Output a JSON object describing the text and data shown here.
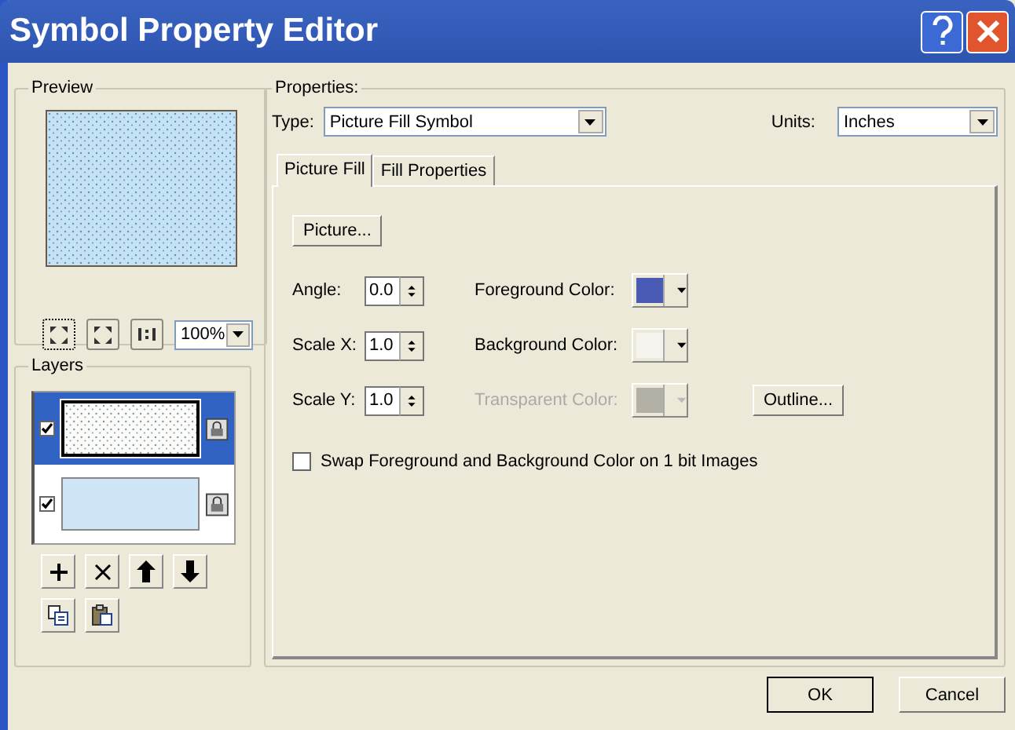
{
  "window": {
    "title": "Symbol Property Editor"
  },
  "preview": {
    "label": "Preview",
    "zoom": "100%"
  },
  "layers": {
    "label": "Layers",
    "items": [
      {
        "kind": "picture",
        "selected": true,
        "checked": true
      },
      {
        "kind": "solid",
        "selected": false,
        "checked": true
      }
    ]
  },
  "properties": {
    "label": "Properties:",
    "type_label": "Type:",
    "type": "Picture Fill Symbol",
    "units_label": "Units:",
    "units": "Inches",
    "tabs": [
      {
        "label": "Picture Fill",
        "selected": true
      },
      {
        "label": "Fill Properties",
        "selected": false
      }
    ],
    "picture_button": "Picture...",
    "spinners": [
      {
        "label": "Angle:",
        "value": "0.0"
      },
      {
        "label": "Scale X:",
        "value": "1.0"
      },
      {
        "label": "Scale Y:",
        "value": "1.0"
      }
    ],
    "colors": [
      {
        "label": "Foreground Color:",
        "color": "#4a5bb5",
        "disabled": false
      },
      {
        "label": "Background Color:",
        "color": "#f4f3ee",
        "disabled": false
      },
      {
        "label": "Transparent Color:",
        "color": "#b3b0a6",
        "disabled": true
      }
    ],
    "outline_button": "Outline...",
    "swap": {
      "label": "Swap Foreground and Background Color on 1 bit Images",
      "checked": false
    }
  },
  "buttons": [
    {
      "label": "OK",
      "default": true
    },
    {
      "label": "Cancel",
      "default": false
    }
  ]
}
